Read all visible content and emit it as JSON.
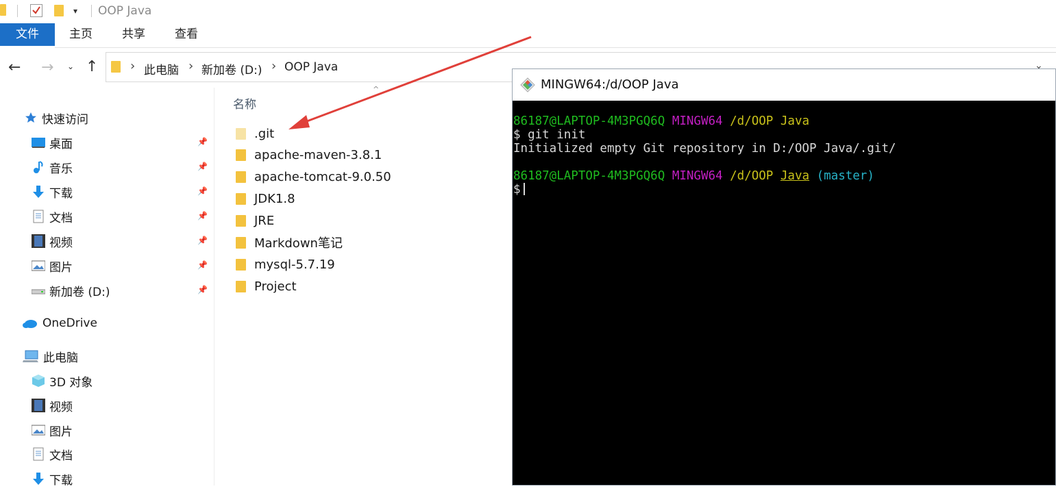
{
  "window": {
    "title": "OOP Java"
  },
  "ribbon": {
    "tabs": [
      "文件",
      "主页",
      "共享",
      "查看"
    ]
  },
  "address": {
    "crumbs": [
      "此电脑",
      "新加卷 (D:)",
      "OOP Java"
    ]
  },
  "sidebar": {
    "quick_access": "快速访问",
    "pinned": [
      "桌面",
      "音乐",
      "下载",
      "文档",
      "视频",
      "图片",
      "新加卷 (D:)"
    ],
    "onedrive": "OneDrive",
    "this_pc": "此电脑",
    "pc_items": [
      "3D 对象",
      "视频",
      "图片",
      "文档",
      "下载"
    ]
  },
  "files": {
    "column_name": "名称",
    "items": [
      ".git",
      "apache-maven-3.8.1",
      "apache-tomcat-9.0.50",
      "JDK1.8",
      "JRE",
      "Markdown笔记",
      "mysql-5.7.19",
      "Project"
    ]
  },
  "terminal": {
    "title": "MINGW64:/d/OOP Java",
    "user_host": "86187@LAPTOP-4M3PGQ6Q",
    "shell": "MINGW64",
    "path_part1": "/d/OOP",
    "path_part2": "Java",
    "command": "$ git init",
    "output": "Initialized empty Git repository in D:/OOP Java/.git/",
    "branch": "(master)",
    "prompt": "$"
  },
  "colors": {
    "file_tab": "#1c6fc7",
    "folder": "#f3c23e",
    "arrow": "#e0403a",
    "term_green": "#1fbb1f",
    "term_magenta": "#c21fc2",
    "term_yellow": "#c9c21a",
    "term_cyan": "#27b3c8"
  }
}
